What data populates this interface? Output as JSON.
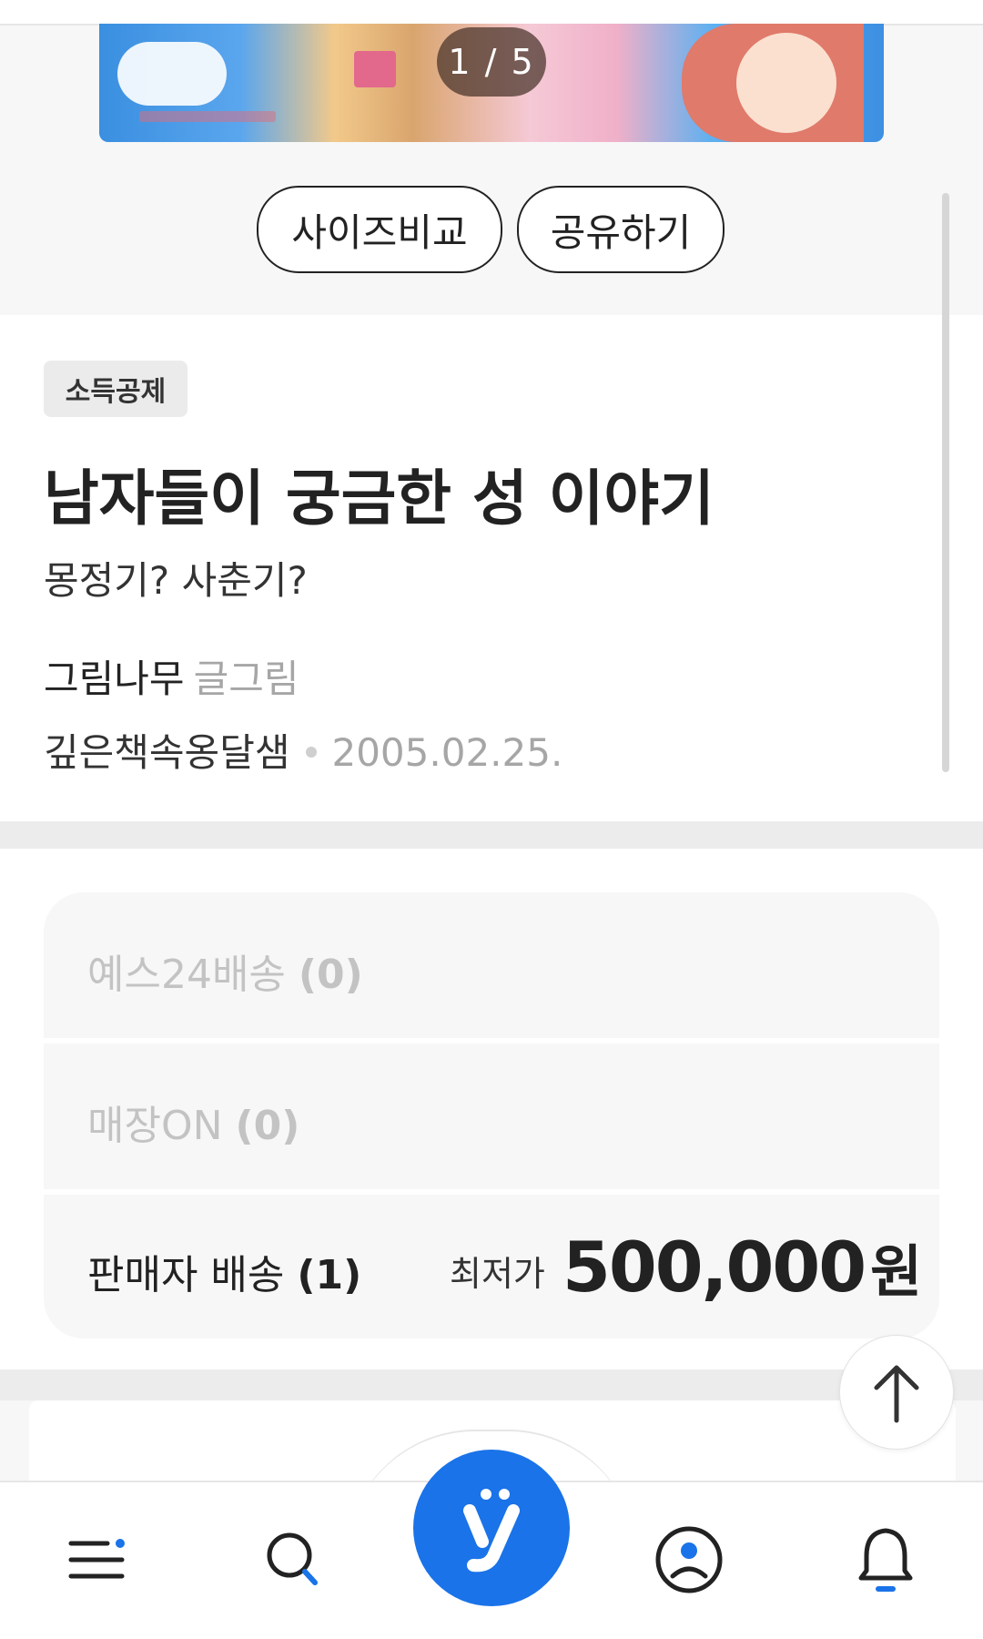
{
  "gallery": {
    "counter": "1 / 5"
  },
  "actions": {
    "size_compare": "사이즈비교",
    "share": "공유하기"
  },
  "product": {
    "badge": "소득공제",
    "title": "남자들이 궁금한 성 이야기",
    "subtitle": "몽정기? 사춘기?",
    "author": "그림나무",
    "author_role": "글그림",
    "publisher": "깊은책속옹달샘",
    "pub_date": "2005.02.25."
  },
  "delivery": {
    "rows": [
      {
        "label": "예스24배송",
        "count": "(0)",
        "enabled": false
      },
      {
        "label": "매장ON",
        "count": "(0)",
        "enabled": false
      },
      {
        "label": "판매자 배송",
        "count": "(1)",
        "enabled": true
      }
    ],
    "lowest_price_label": "최저가",
    "lowest_price": "500,000",
    "currency": "원"
  },
  "nav": {
    "items": [
      "menu-icon",
      "search-icon",
      "yes24-home-icon",
      "mypage-icon",
      "notification-bell-icon"
    ]
  },
  "colors": {
    "accent": "#1a73e8",
    "text": "#222222",
    "muted": "#a6a6a6",
    "disabled": "#c3c3c3"
  }
}
